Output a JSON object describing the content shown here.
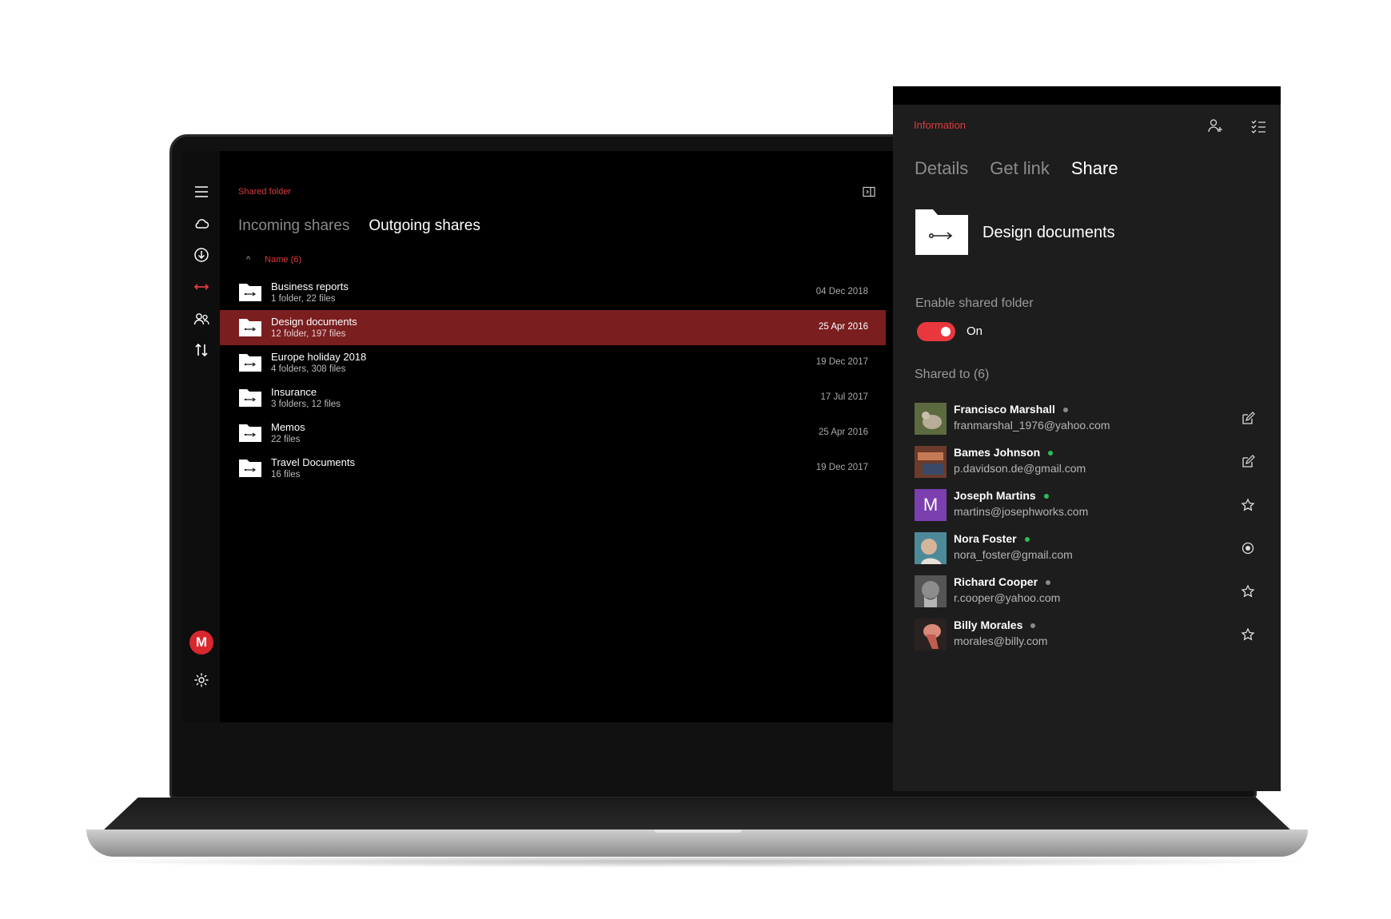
{
  "main": {
    "section_label": "Shared folder",
    "tabs": [
      {
        "label": "Incoming shares",
        "active": false
      },
      {
        "label": "Outgoing shares",
        "active": true
      }
    ],
    "sort_label": "Name (6)",
    "files": [
      {
        "name": "Business reports",
        "meta": "1 folder, 22 files",
        "date": "04 Dec 2018",
        "selected": false
      },
      {
        "name": "Design documents",
        "meta": "12 folder, 197 files",
        "date": "25 Apr 2016",
        "selected": true
      },
      {
        "name": "Europe holiday 2018",
        "meta": "4 folders, 308 files",
        "date": "19 Dec 2017",
        "selected": false
      },
      {
        "name": "Insurance",
        "meta": "3 folders, 12 files",
        "date": "17 Jul 2017",
        "selected": false
      },
      {
        "name": "Memos",
        "meta": "22 files",
        "date": "25 Apr 2016",
        "selected": false
      },
      {
        "name": "Travel Documents",
        "meta": "16 files",
        "date": "19 Dec 2017",
        "selected": false
      }
    ]
  },
  "sidebar": {
    "logo_letter": "M",
    "icons": [
      "menu-icon",
      "cloud-icon",
      "download-icon",
      "shared-arrows-icon",
      "contacts-icon",
      "transfers-icon",
      "settings-icon"
    ]
  },
  "info": {
    "title": "Information",
    "tabs": [
      {
        "label": "Details",
        "active": false
      },
      {
        "label": "Get link",
        "active": false
      },
      {
        "label": "Share",
        "active": true
      }
    ],
    "folder_name": "Design documents",
    "enable_label": "Enable shared folder",
    "toggle_state": "On",
    "shared_label": "Shared to (6)",
    "contacts": [
      {
        "name": "Francisco Marshall",
        "email": "franmarshal_1976@yahoo.com",
        "online": false,
        "action": "edit-icon",
        "avatar": "photo"
      },
      {
        "name": "Bames Johnson",
        "email": "p.davidson.de@gmail.com",
        "online": true,
        "action": "edit-icon",
        "avatar": "photo"
      },
      {
        "name": "Joseph Martins",
        "email": "martins@josephworks.com",
        "online": true,
        "action": "star-icon",
        "avatar": "M"
      },
      {
        "name": "Nora Foster",
        "email": "nora_foster@gmail.com",
        "online": true,
        "action": "eye-icon",
        "avatar": "photo"
      },
      {
        "name": "Richard Cooper",
        "email": "r.cooper@yahoo.com",
        "online": false,
        "action": "star-icon",
        "avatar": "photo"
      },
      {
        "name": "Billy Morales",
        "email": "morales@billy.com",
        "online": false,
        "action": "star-icon",
        "avatar": "photo"
      }
    ]
  },
  "colors": {
    "accent": "#e03a3e",
    "selected_row": "#7a1e20",
    "online": "#2ebd59",
    "offline": "#8a8a8a",
    "panel_bg": "#1d1d1d"
  }
}
